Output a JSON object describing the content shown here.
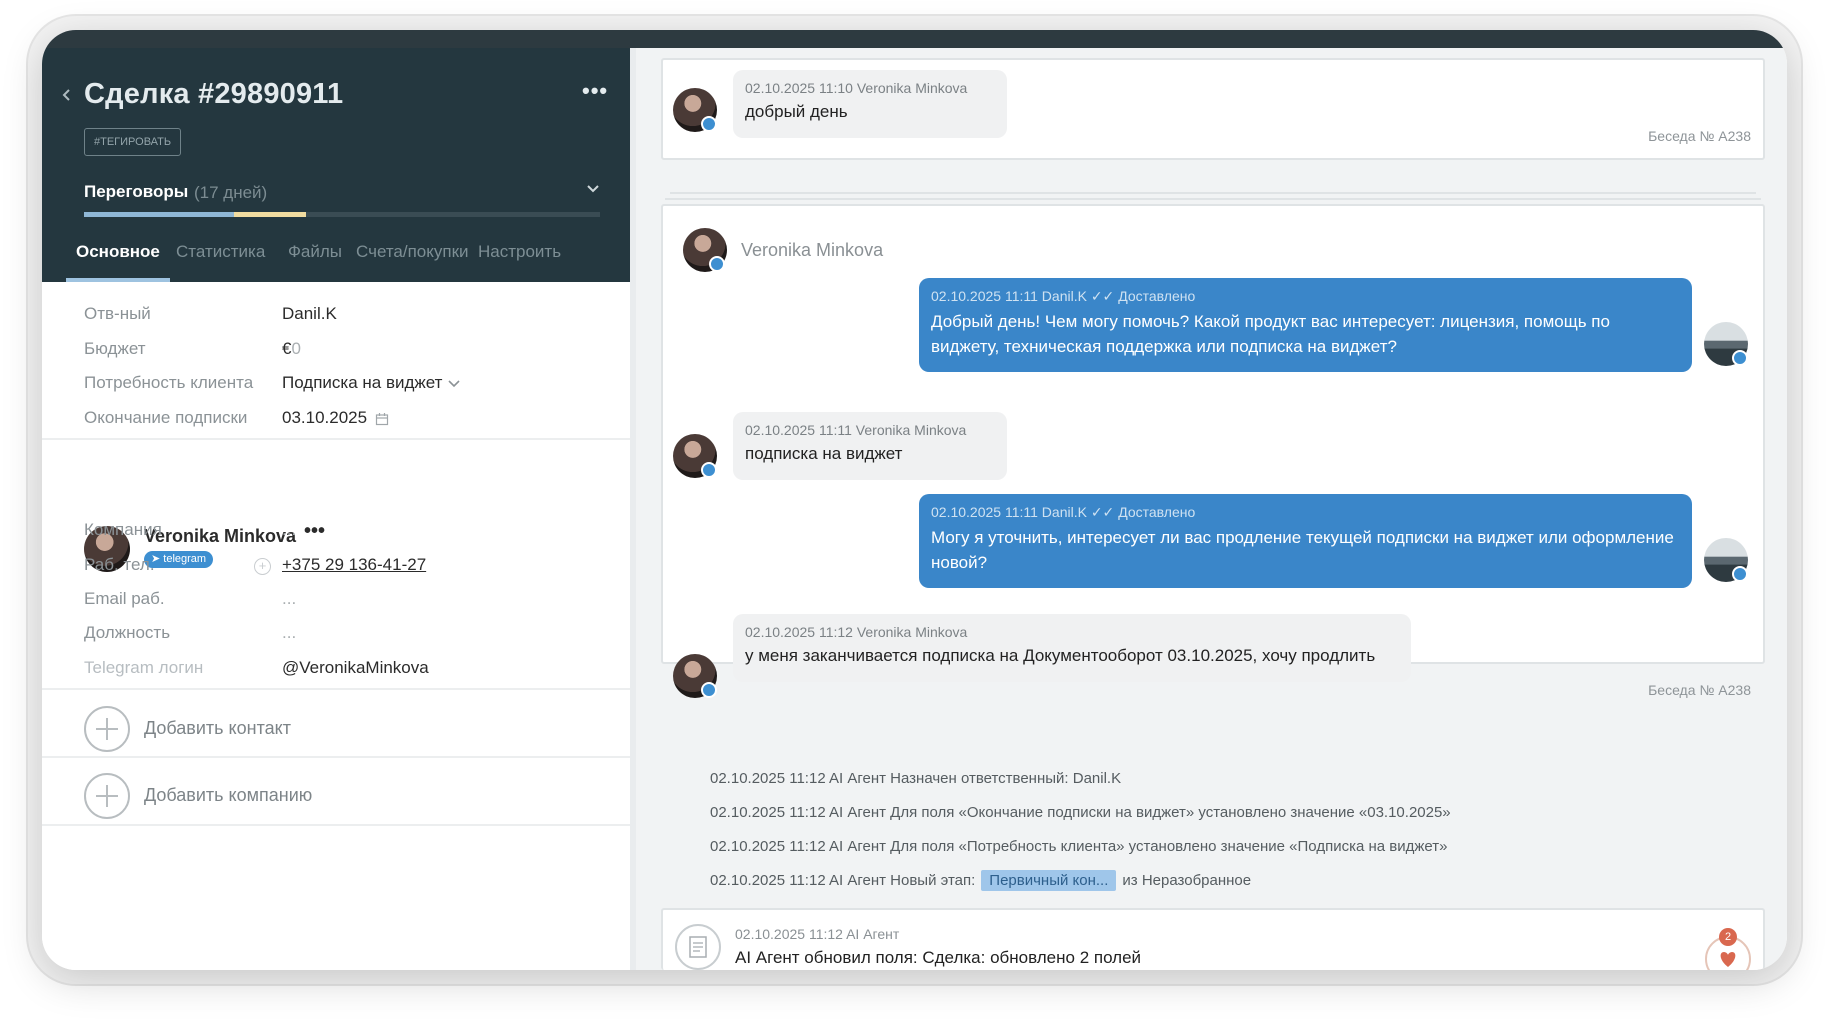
{
  "deal": {
    "title": "Сделка #29890911",
    "tag_button": "#ТЕГИРОВАТЬ",
    "more": "•••",
    "stage": {
      "name": "Переговоры",
      "days": "(17 дней)",
      "progress_blue": 0.29,
      "progress_yellow": 0.14
    },
    "tabs": [
      "Основное",
      "Статистика",
      "Файлы",
      "Счета/покупки",
      "Настроить"
    ],
    "active_tab": 0
  },
  "fields": [
    {
      "label": "Отв-ный",
      "value": "Danil.K"
    },
    {
      "label": "Бюджет",
      "value": "€",
      "value_suffix": "0"
    },
    {
      "label": "Потребность клиента",
      "value": "Подписка на виджет"
    },
    {
      "label": "Окончание подписки",
      "value": "03.10.2025"
    }
  ],
  "contact": {
    "name": "Veronika Minkova",
    "more": "•••",
    "badge": "telegram",
    "fields": [
      {
        "label": "Компания",
        "value": "..."
      },
      {
        "label": "Раб. тел.",
        "value": "+375 29 136-41-27"
      },
      {
        "label": "Email раб.",
        "value": "..."
      },
      {
        "label": "Должность",
        "value": "..."
      },
      {
        "label": "Telegram логин",
        "value": "@VeronikaMinkova"
      }
    ]
  },
  "actions": {
    "add_contact": "Добавить контакт",
    "add_company": "Добавить компанию"
  },
  "chat": {
    "conversation_label": "Беседа № A238",
    "first_card": {
      "meta": "02.10.2025 11:10 Veronika Minkova",
      "text": "добрый день"
    },
    "header_name": "Veronika Minkova",
    "messages": [
      {
        "direction": "out",
        "meta": "02.10.2025 11:11 Danil.K",
        "status": "Доставлено",
        "text": "Добрый день! Чем могу помочь? Какой продукт вас интересует: лицензия, помощь по виджету, техническая поддержка или подписка на виджет?"
      },
      {
        "direction": "in",
        "meta": "02.10.2025 11:11 Veronika Minkova",
        "text": "подписка на виджет"
      },
      {
        "direction": "out",
        "meta": "02.10.2025 11:11 Danil.K",
        "status": "Доставлено",
        "text": "Могу я уточнить, интересует ли вас продление текущей подписки на виджет или оформление новой?"
      },
      {
        "direction": "in",
        "meta": "02.10.2025 11:12 Veronika Minkova",
        "text": "у меня заканчивается подписка на Документооборот 03.10.2025, хочу продлить"
      }
    ]
  },
  "log": [
    "02.10.2025 11:12 AI Агент Назначен ответственный: Danil.K",
    "02.10.2025 11:12 AI Агент Для поля «Окончание подписки на виджет» установлено значение «03.10.2025»",
    "02.10.2025 11:12 AI Агент Для поля «Потребность клиента» установлено значение «Подписка на виджет»"
  ],
  "stage_change": {
    "prefix": "02.10.2025 11:12 AI Агент Новый этап:",
    "chip": "Первичный кон...",
    "suffix": "из Неразобранное"
  },
  "note": {
    "meta": "02.10.2025 11:12 AI Агент",
    "text": "AI Агент обновил поля: Сделка: обновлено 2 полей",
    "heart_count": "2"
  },
  "colors": {
    "header_bg": "#24373f",
    "accent_blue": "#3a86c9",
    "chip_blue": "#9fc6ea",
    "badge_red": "#d9684f"
  }
}
